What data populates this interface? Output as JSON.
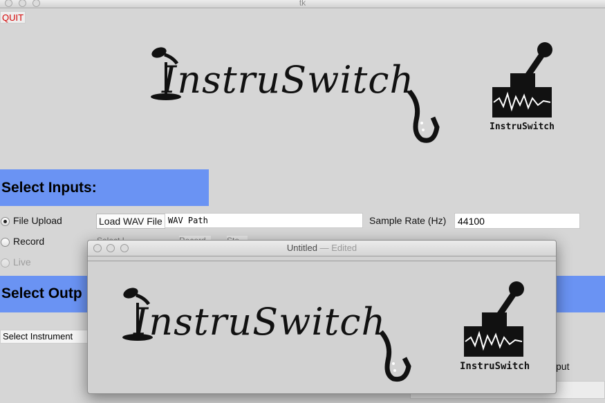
{
  "window": {
    "title": "tk"
  },
  "quit_label": "QUIT",
  "logo": {
    "wordmark": "InstruSwitch",
    "badge_text": "InstruSwitch"
  },
  "inputs": {
    "heading": "Select Inputs:",
    "options": [
      {
        "label": "File Upload",
        "selected": true
      },
      {
        "label": "Record",
        "selected": false
      },
      {
        "label": "Live",
        "selected": false,
        "disabled": true
      }
    ],
    "load_button": "Load WAV File",
    "wav_path": "WAV Path",
    "sample_rate_label": "Sample Rate (Hz)",
    "sample_rate_value": "44100",
    "partial_select": "Select I",
    "partial_button_1": "Record",
    "partial_button_2": "Sto"
  },
  "outputs": {
    "heading": "Select Outp",
    "instrument_select": "Select Instrument",
    "partial_label": "put"
  },
  "popup": {
    "title": "Untitled",
    "title_suffix": "— Edited",
    "logo_wordmark": "InstruSwitch",
    "badge_text": "InstruSwitch"
  },
  "colors": {
    "band": "#6a93f3",
    "quit_text": "#d40000",
    "background": "#d6d6d6"
  }
}
